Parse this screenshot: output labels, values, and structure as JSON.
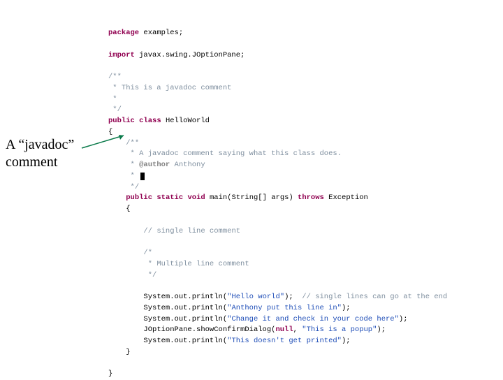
{
  "annotation": {
    "line1": "A “javadoc”",
    "line2": "comment"
  },
  "code": {
    "kw_package": "package",
    "pkg_name": " examples;",
    "kw_import": "import",
    "import_stmt": " javax.swing.JOptionPane;",
    "jdoc1_open": "/**",
    "jdoc1_l1": " * This is a javadoc comment",
    "jdoc1_l2": " *",
    "jdoc1_close": " */",
    "kw_public": "public",
    "kw_class": "class",
    "class_name": " HelloWorld",
    "brace_open": "{",
    "jdoc2_open": "/**",
    "jdoc2_l1": " * A javadoc comment saying what this class does.",
    "jdoc2_l2_star": " * ",
    "jdoc2_tag": "@author",
    "jdoc2_author": " Anthony",
    "jdoc2_l3": " * ",
    "jdoc2_close": " */",
    "kw_static": "static",
    "kw_void": "void",
    "method_name": " main",
    "method_params": "(String[] args) ",
    "kw_throws": "throws",
    "exception": " Exception",
    "m_brace_open": "{",
    "single_cmt": "// single line comment",
    "multi_open": "/*",
    "multi_l1": " * Multiple line comment",
    "multi_close": " */",
    "sys_out": "System.out.println(",
    "jopt": "JOptionPane.showConfirmDialog(",
    "null_kw": "null",
    "comma_sp": ", ",
    "paren_semi": ");",
    "str1": "\"Hello world\"",
    "end_cmt": "  // single lines can go at the end",
    "str2": "\"Anthony put this line in\"",
    "str3": "\"Change it and check in your code here\"",
    "str4": "\"This is a popup\"",
    "str5": "\"This doesn't get printed\"",
    "m_brace_close": "}",
    "brace_close": "}"
  }
}
